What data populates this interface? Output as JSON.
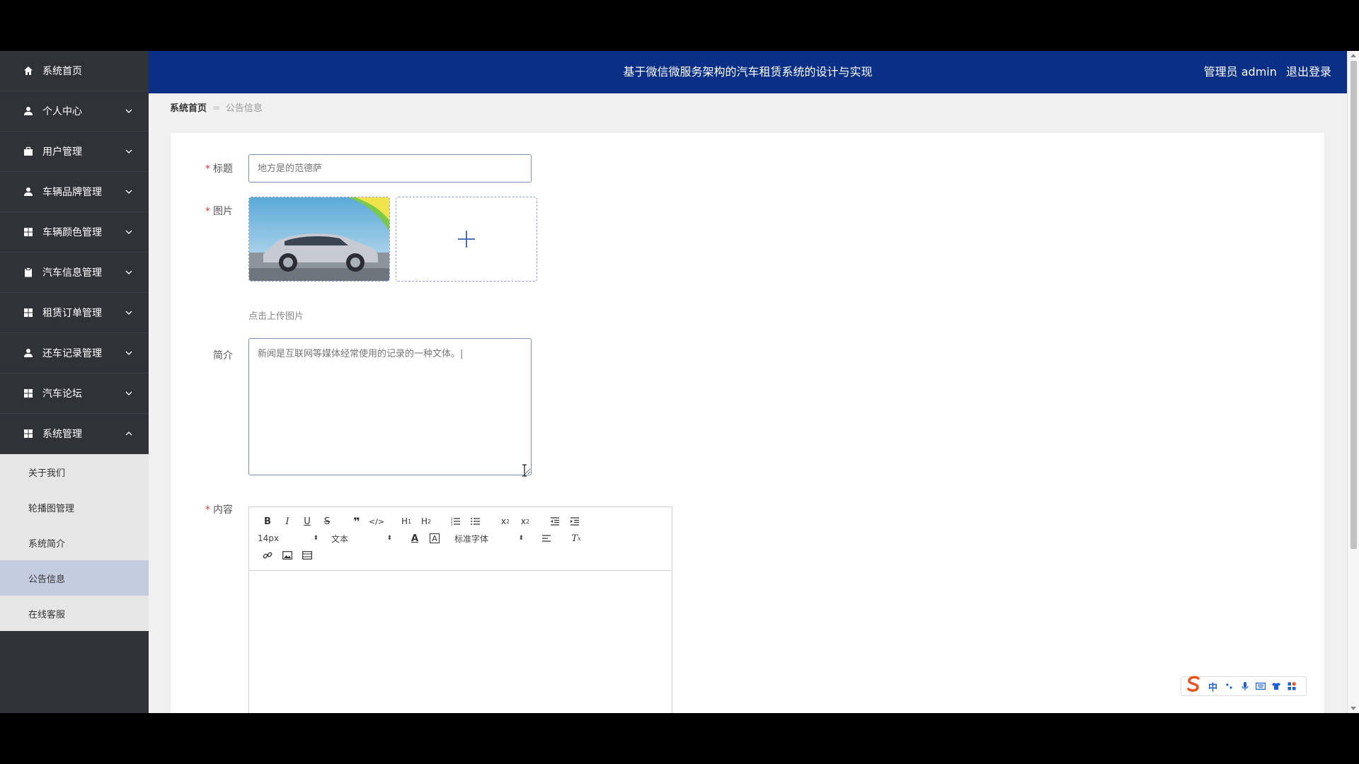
{
  "header": {
    "title": "基于微信微服务架构的汽车租赁系统的设计与实现",
    "user_role": "管理员 admin",
    "logout": "退出登录"
  },
  "sidebar": {
    "items": [
      {
        "label": "系统首页",
        "icon": "home-icon",
        "has_chevron": false
      },
      {
        "label": "个人中心",
        "icon": "person-icon",
        "has_chevron": true
      },
      {
        "label": "用户管理",
        "icon": "briefcase-icon",
        "has_chevron": true
      },
      {
        "label": "车辆品牌管理",
        "icon": "person-icon",
        "has_chevron": true
      },
      {
        "label": "车辆颜色管理",
        "icon": "grid-icon",
        "has_chevron": true
      },
      {
        "label": "汽车信息管理",
        "icon": "clipboard-icon",
        "has_chevron": true
      },
      {
        "label": "租赁订单管理",
        "icon": "grid-icon",
        "has_chevron": true
      },
      {
        "label": "还车记录管理",
        "icon": "person-icon",
        "has_chevron": true
      },
      {
        "label": "汽车论坛",
        "icon": "grid-icon",
        "has_chevron": true
      },
      {
        "label": "系统管理",
        "icon": "grid-icon",
        "has_chevron": true,
        "expanded": true
      }
    ],
    "submenu": [
      {
        "label": "关于我们",
        "active": false
      },
      {
        "label": "轮播图管理",
        "active": false
      },
      {
        "label": "系统简介",
        "active": false
      },
      {
        "label": "公告信息",
        "active": true
      },
      {
        "label": "在线客服",
        "active": false
      }
    ]
  },
  "breadcrumb": {
    "home": "系统首页",
    "current": "公告信息"
  },
  "form": {
    "title_label": "标题",
    "title_value": "地方是的范德萨",
    "image_label": "图片",
    "upload_tip": "点击上传图片",
    "intro_label": "简介",
    "intro_value": "新闻是互联网等媒体经常使用的记录的一种文体。|",
    "content_label": "内容"
  },
  "editor": {
    "font_size": "14px",
    "paragraph": "文本",
    "font_family": "标准字体"
  },
  "ime": {
    "lang": "中"
  },
  "colors": {
    "header_bg": "#0a2f87",
    "sidebar_bg": "#2f3237",
    "submenu_active": "#c4cce0",
    "required": "#e4393c"
  }
}
